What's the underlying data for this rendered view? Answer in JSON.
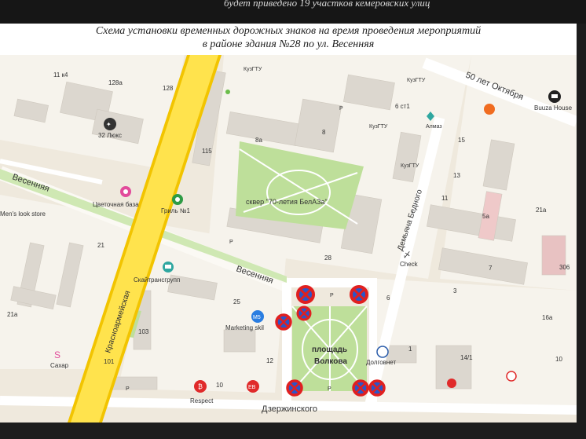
{
  "header": {
    "top_fragment": "будет приведено 19 участков кемеровских улиц",
    "title_line1": "Схема установки временных дорожных знаков на время проведения мероприятий",
    "title_line2": "в районе здания №28 по ул. Весенняя"
  },
  "streets": {
    "vesennyaya_left": "Весенняя",
    "vesennyaya_center": "Весенняя",
    "krasnoarmeyskaya": "Красноармейская",
    "50_let_oktyabrya": "50 лет Октября",
    "demyana_bednogo": "Демьяна Бедного",
    "dzerzhinskogo": "Дзержинского"
  },
  "places": {
    "square_park": "сквер \"70-летия БелАЗа\"",
    "square_volkova_1": "площадь",
    "square_volkova_2": "Волкова",
    "lux": "32 Люкс",
    "flower_base": "Цветочная база",
    "grill": "Гриль №1",
    "mens_look": "Men's look store",
    "skytrans": "Скайтрансгрупп",
    "marketing": "Marketing skil",
    "kuzgtu_1": "КузГТУ",
    "kuzgtu_2": "КузГТУ",
    "kuzgtu_3": "КузГТУ",
    "kuzgtu_4": "КузГТУ",
    "almaz": "Алмаз",
    "buuza": "Buuza House",
    "check": "Check",
    "dolgovnet": "Долговнет",
    "sahar": "Сахар",
    "respect": "Respect"
  },
  "houses": {
    "h11k4": "11 к4",
    "h128a": "128а",
    "h128": "128",
    "h115": "115",
    "h8a": "8а",
    "h8": "8",
    "h6st1": "6 ст1",
    "h28": "28",
    "h21": "21",
    "h21a_left": "21а",
    "h25": "25",
    "h103": "103",
    "h101": "101",
    "h10": "10",
    "h12": "12",
    "h6": "6",
    "h11": "11",
    "h13": "13",
    "h15": "15",
    "h5a": "5а",
    "h21a_right": "21а",
    "h7": "7",
    "h3": "3",
    "h1": "1",
    "h14_1": "14/1",
    "h16a": "16а",
    "h306": "306",
    "h10_right": "10"
  },
  "icons": {
    "no_parking": "no-parking-sign-icon",
    "pin": "map-pin-icon",
    "parking": "P"
  },
  "colors": {
    "map_bg": "#efe9dd",
    "block": "#f6f3ec",
    "building": "#dcd7cf",
    "park": "#bedf9a",
    "road_white": "#ffffff",
    "main_road": "#ffe34d",
    "main_road_edge": "#f2c400",
    "sign_red": "#e02020",
    "sign_blue": "#2b55c8"
  }
}
